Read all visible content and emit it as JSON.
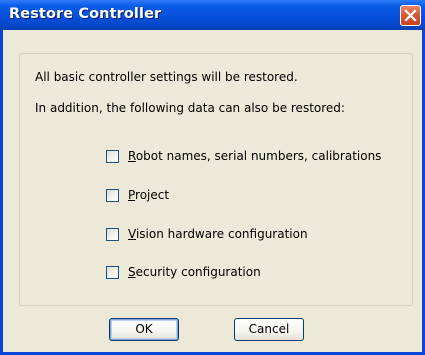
{
  "window": {
    "title": "Restore Controller",
    "close_icon": "close-icon"
  },
  "dialog": {
    "line1": "All basic controller settings will be restored.",
    "line2": "In addition, the following data can also be restored:",
    "options": [
      {
        "accel": "R",
        "rest": "obot names, serial numbers, calibrations",
        "checked": false
      },
      {
        "accel": "P",
        "rest": "roject",
        "checked": false
      },
      {
        "accel": "V",
        "rest": "ision hardware configuration",
        "checked": false
      },
      {
        "accel": "S",
        "rest": "ecurity configuration",
        "checked": false
      }
    ]
  },
  "buttons": {
    "ok": "OK",
    "cancel": "Cancel"
  },
  "colors": {
    "titlebar": "#0650dc",
    "dialog_bg": "#ece9d8",
    "close_button": "#d95a33"
  }
}
